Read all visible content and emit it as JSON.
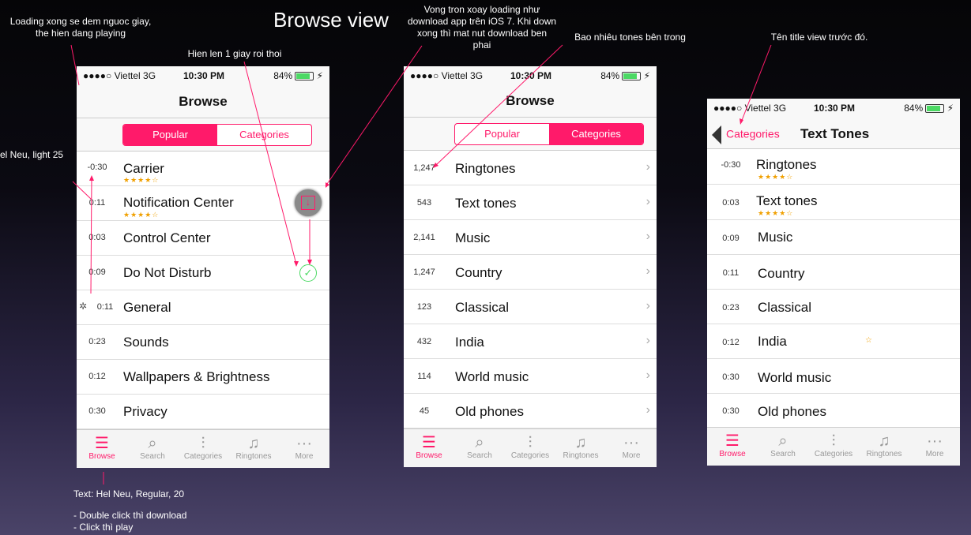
{
  "title": "Browse view",
  "notes": {
    "loading": "Loading xong se dem nguoc giay, the hien dang playing",
    "show1s": "Hien len 1 giay roi thoi",
    "spinner": "Vong tron xoay loading như download app trên iOS 7. Khi down xong thì mat nut download ben phai",
    "count": "Bao nhiêu tones bên trong",
    "prevtitle": "Tên title view trước đó.",
    "font": "el Neu, light 25",
    "text_font": "Text: Hel Neu, Regular, 20",
    "dbl": "- Double click thì download",
    "click": "- Click thì play"
  },
  "status": {
    "carrier": "●●●●○ Viettel   3G",
    "time": "10:30 PM",
    "battery": "84%"
  },
  "tabs": [
    "Browse",
    "Search",
    "Categories",
    "Ringtones",
    "More"
  ],
  "phone1": {
    "title": "Browse",
    "seg": [
      "Popular",
      "Categories"
    ],
    "rows": [
      {
        "num": "-0:30",
        "label": "Carrier",
        "stars": "★★★★☆"
      },
      {
        "num": "0:11",
        "label": "Notification Center",
        "stars": "★★★★☆"
      },
      {
        "num": "0:03",
        "label": "Control Center",
        "stars": ""
      },
      {
        "num": "0:09",
        "label": "Do Not Disturb",
        "stars": ""
      },
      {
        "num": "0:11",
        "label": "General",
        "stars": ""
      },
      {
        "num": "0:23",
        "label": "Sounds",
        "stars": ""
      },
      {
        "num": "0:12",
        "label": "Wallpapers & Brightness",
        "stars": ""
      },
      {
        "num": "0:30",
        "label": "Privacy",
        "stars": ""
      }
    ]
  },
  "phone2": {
    "title": "Browse",
    "seg": [
      "Popular",
      "Categories"
    ],
    "rows": [
      {
        "num": "1,247",
        "label": "Ringtones"
      },
      {
        "num": "543",
        "label": "Text tones"
      },
      {
        "num": "2,141",
        "label": "Music"
      },
      {
        "num": "1,247",
        "label": "Country"
      },
      {
        "num": "123",
        "label": "Classical"
      },
      {
        "num": "432",
        "label": "India"
      },
      {
        "num": "114",
        "label": "World music"
      },
      {
        "num": "45",
        "label": "Old phones"
      }
    ]
  },
  "phone3": {
    "back": "Categories",
    "title": "Text Tones",
    "rows": [
      {
        "num": "-0:30",
        "label": "Ringtones",
        "stars": "★★★★☆"
      },
      {
        "num": "0:03",
        "label": "Text tones",
        "stars": "★★★★☆"
      },
      {
        "num": "0:09",
        "label": "Music",
        "stars": ""
      },
      {
        "num": "0:11",
        "label": "Country",
        "stars": ""
      },
      {
        "num": "0:23",
        "label": "Classical",
        "stars": ""
      },
      {
        "num": "0:12",
        "label": "India",
        "stars": "☆"
      },
      {
        "num": "0:30",
        "label": "World music",
        "stars": ""
      },
      {
        "num": "0:30",
        "label": "Old phones",
        "stars": ""
      }
    ]
  }
}
